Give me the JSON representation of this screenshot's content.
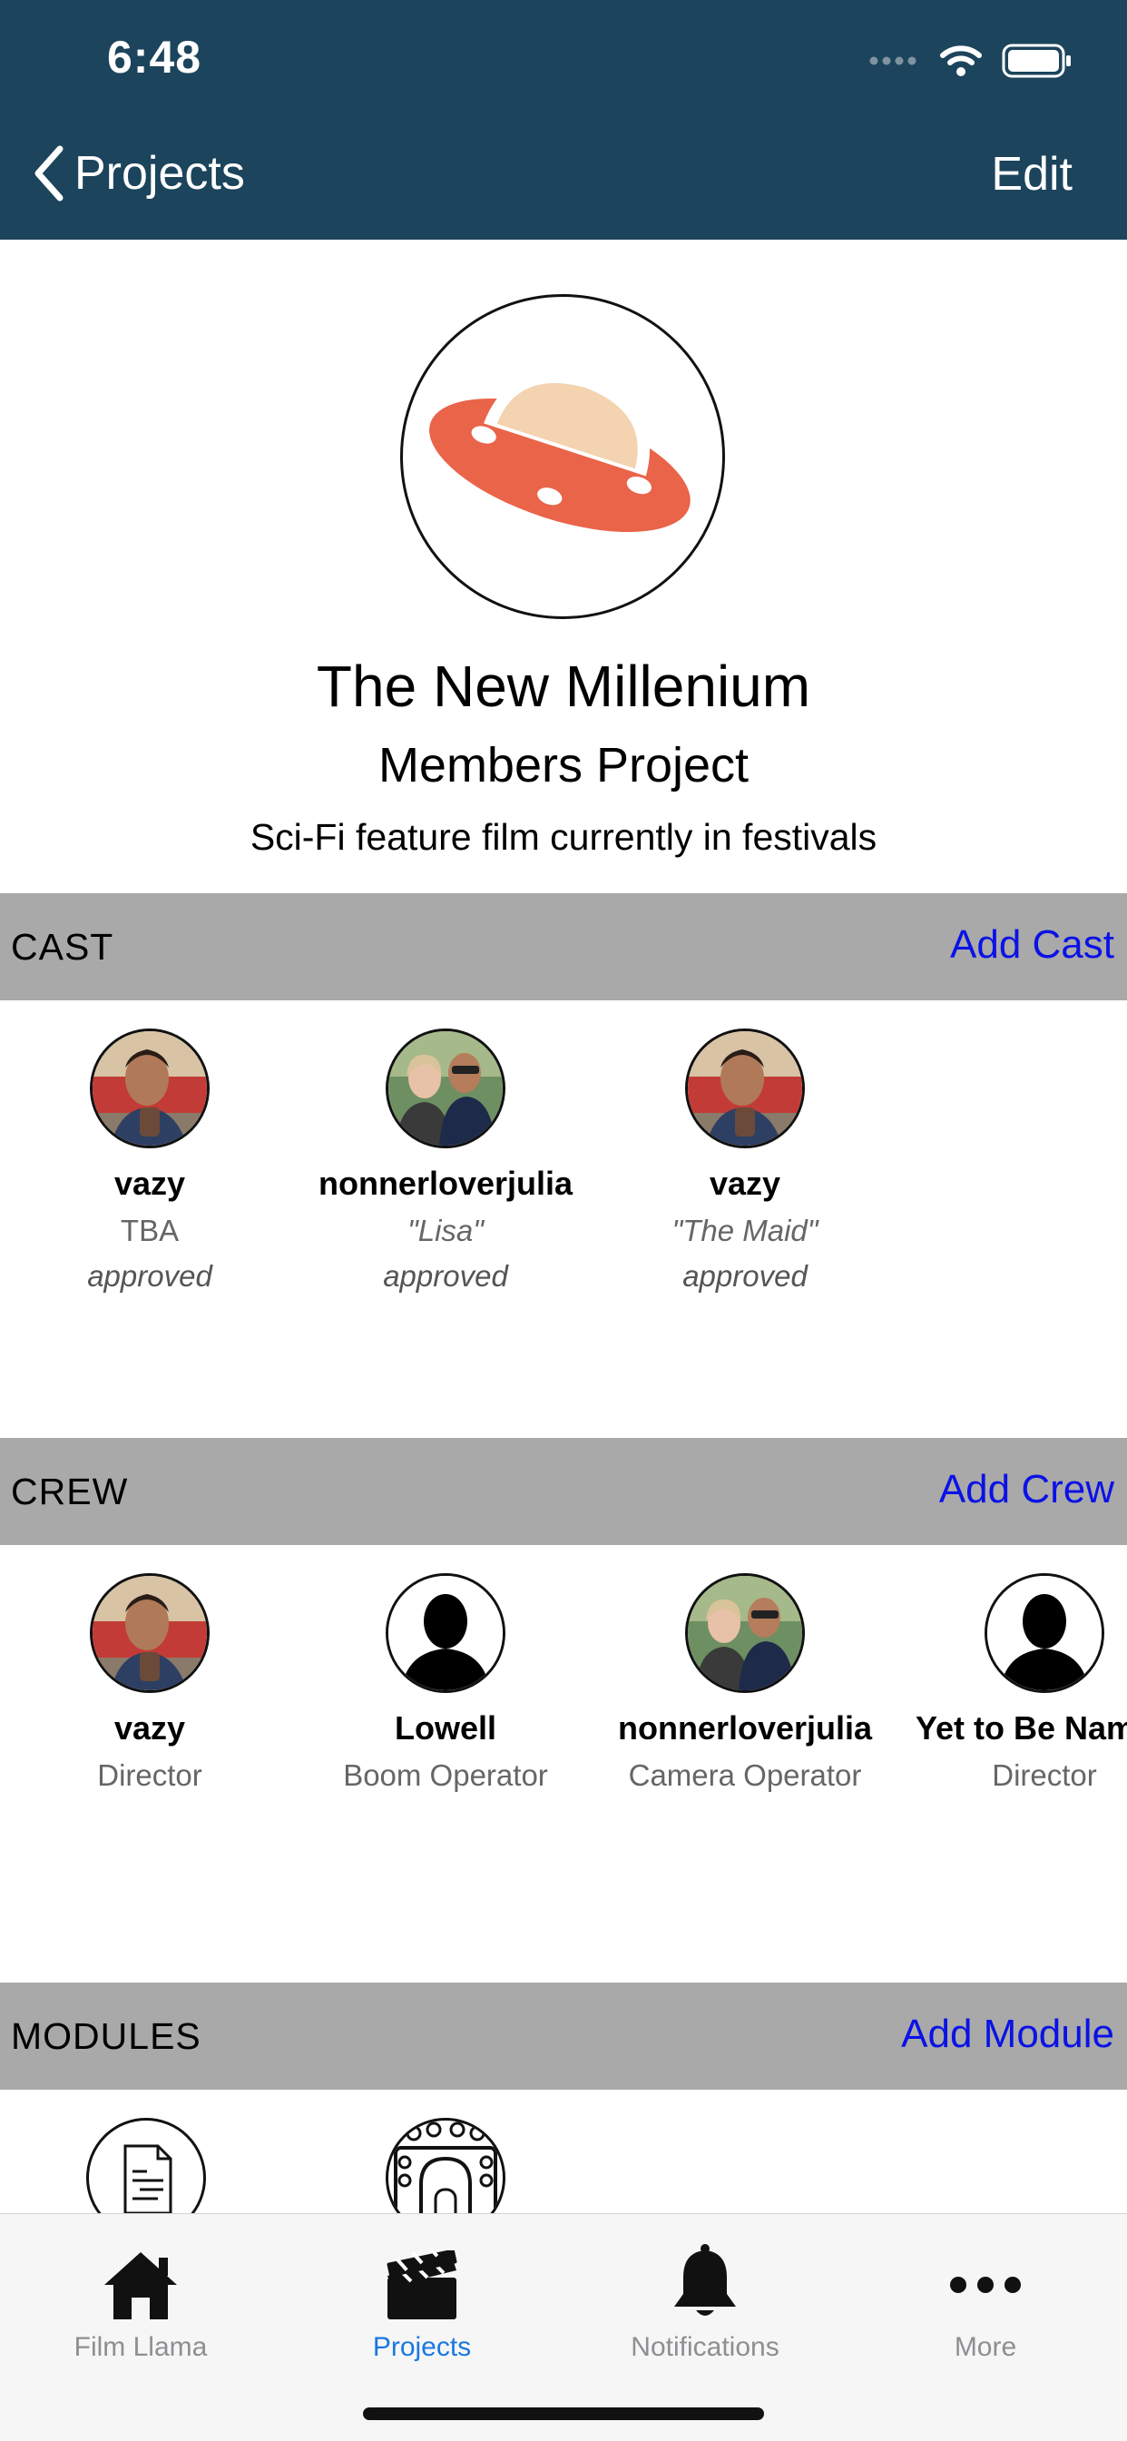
{
  "status_bar": {
    "time": "6:48"
  },
  "nav": {
    "back_label": "Projects",
    "edit_label": "Edit"
  },
  "project": {
    "title": "The New Millenium",
    "subtitle": "Members Project",
    "description": "Sci-Fi feature film currently in festivals"
  },
  "cast": {
    "title": "CAST",
    "add_label": "Add Cast",
    "members": [
      {
        "name": "vazy",
        "role": "TBA",
        "status": "approved",
        "avatar": "man-selfie-photo"
      },
      {
        "name": "nonnerloverjulia",
        "role": "\"Lisa\"",
        "status": "approved",
        "avatar": "couple-photo"
      },
      {
        "name": "vazy",
        "role": "\"The Maid\"",
        "status": "approved",
        "avatar": "man-selfie-photo"
      }
    ]
  },
  "crew": {
    "title": "CREW",
    "add_label": "Add Crew",
    "members": [
      {
        "name": "vazy",
        "role": "Director",
        "avatar": "man-selfie-photo"
      },
      {
        "name": "Lowell",
        "role": "Boom Operator",
        "avatar": "silhouette-icon"
      },
      {
        "name": "nonnerloverjulia",
        "role": "Camera Operator",
        "avatar": "couple-photo"
      },
      {
        "name": "Yet to Be Named",
        "role": "Director",
        "avatar": "silhouette-icon"
      }
    ]
  },
  "modules": {
    "title": "MODULES",
    "add_label": "Add Module",
    "items": [
      {
        "icon": "document-icon"
      },
      {
        "icon": "theater-stage-icon"
      }
    ]
  },
  "tabbar": {
    "tabs": [
      {
        "label": "Film Llama",
        "icon": "home-icon"
      },
      {
        "label": "Projects",
        "icon": "clapperboard-icon",
        "active": true
      },
      {
        "label": "Notifications",
        "icon": "bell-icon"
      },
      {
        "label": "More",
        "icon": "more-icon"
      }
    ]
  },
  "colors": {
    "header": "#1c445c",
    "section_bar": "#a9a9a9",
    "add_link": "#0a12e6",
    "tab_active": "#1a78e0",
    "tab_inactive": "#8e8e93",
    "ufo_body": "#ea6449",
    "ufo_dome": "#f3d3b0"
  }
}
